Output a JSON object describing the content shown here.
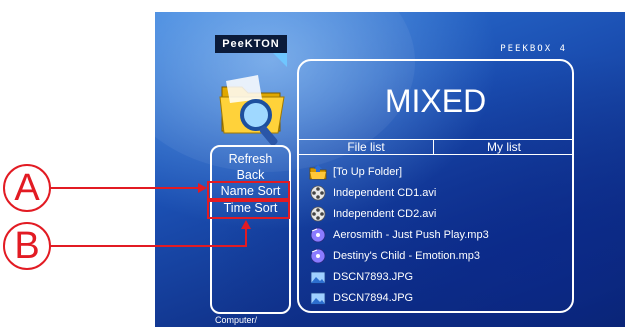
{
  "brand": {
    "logo_text": "PeeKTON",
    "model": "PEEKBOX 4"
  },
  "colors": {
    "annotation": "#e21b23",
    "panel_border": "#ffffff",
    "background": "#1b4fb2"
  },
  "side_menu": {
    "items": [
      {
        "label": "Refresh",
        "icon": "none"
      },
      {
        "label": "Back",
        "icon": "none"
      },
      {
        "label": "Name Sort",
        "icon": "none"
      },
      {
        "label": "Time Sort",
        "icon": "none"
      }
    ],
    "path": "Computer/"
  },
  "main": {
    "title": "MIXED",
    "tabs": [
      {
        "label": "File list"
      },
      {
        "label": "My list"
      }
    ],
    "files": [
      {
        "name": "[To Up Folder]",
        "icon": "folder-up-icon"
      },
      {
        "name": "Independent CD1.avi",
        "icon": "film-reel-icon"
      },
      {
        "name": "Independent CD2.avi",
        "icon": "film-reel-icon"
      },
      {
        "name": "Aerosmith - Just Push Play.mp3",
        "icon": "music-disc-icon"
      },
      {
        "name": "Destiny's Child - Emotion.mp3",
        "icon": "music-disc-icon"
      },
      {
        "name": "DSCN7893.JPG",
        "icon": "photo-icon"
      },
      {
        "name": "DSCN7894.JPG",
        "icon": "photo-icon"
      }
    ]
  },
  "annotations": {
    "a_label": "A",
    "b_label": "B"
  }
}
